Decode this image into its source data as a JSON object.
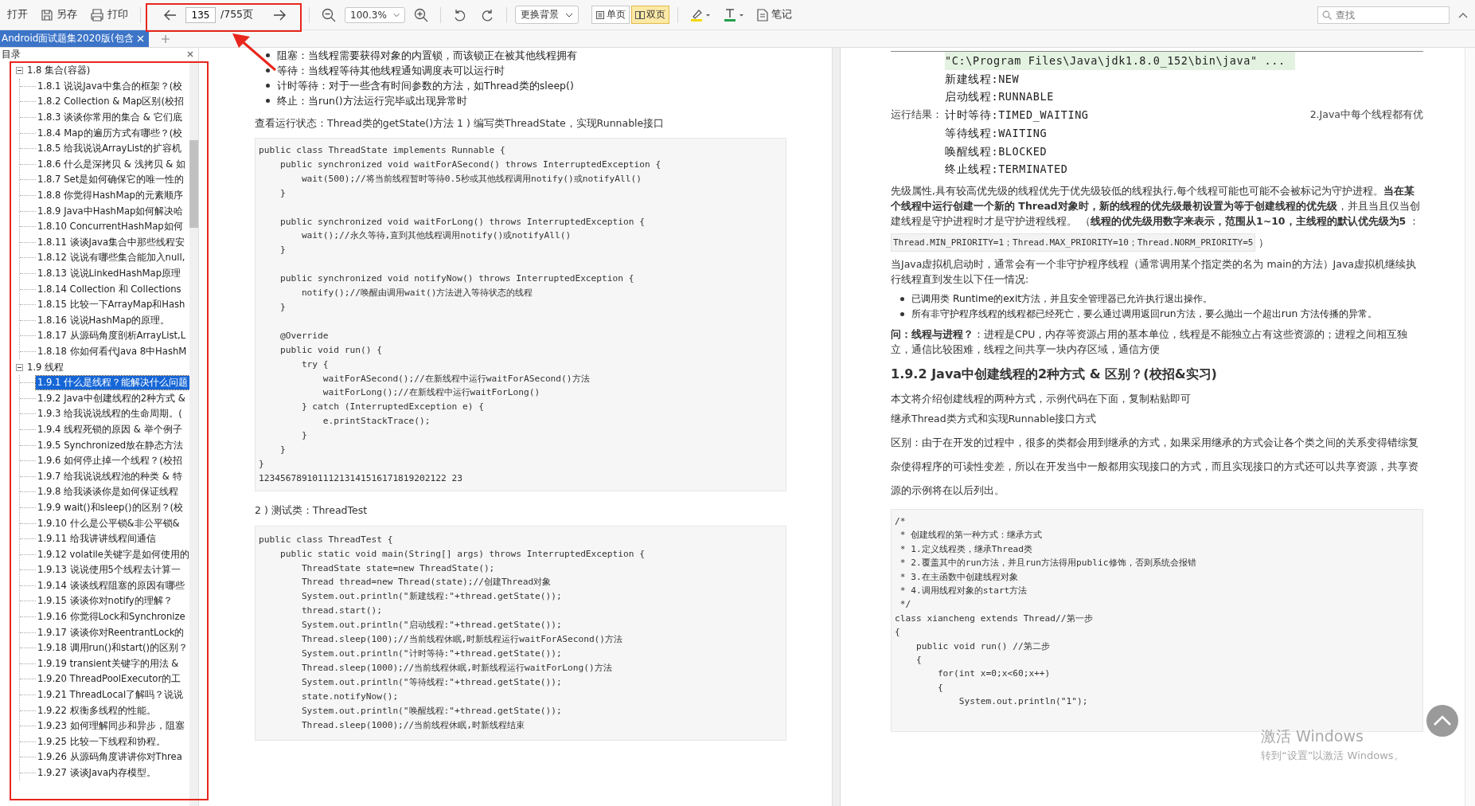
{
  "toolbar": {
    "open_button": {
      "label": "打开"
    },
    "save_button": {
      "label": "另存"
    },
    "print_button": {
      "label": "打印"
    },
    "page_nav": {
      "current": "135",
      "total": "/755页"
    },
    "zoom": {
      "value": "100.3%"
    },
    "background_select": {
      "label": "更换背景"
    },
    "view_modes": [
      {
        "label": "单页",
        "selected": false
      },
      {
        "label": "双页",
        "selected": true
      }
    ],
    "note_button": {
      "label": "笔记"
    },
    "search": {
      "placeholder": "查找"
    }
  },
  "tabs": [
    {
      "label": "Android面试题集2020版(包含",
      "selected": true
    }
  ],
  "sidebar": {
    "title": "目录",
    "items": [
      {
        "label": "1.8 集合(容器)",
        "expanded": true,
        "selected": false,
        "children": [
          {
            "label": "1.8.1 说说Java中集合的框架？(校",
            "selected": false
          },
          {
            "label": "1.8.2 Collection & Map区别(校招",
            "selected": false
          },
          {
            "label": "1.8.3 谈谈你常用的集合 & 它们底",
            "selected": false
          },
          {
            "label": "1.8.4 Map的遍历方式有哪些？(校",
            "selected": false
          },
          {
            "label": "1.8.5 给我说说ArrayList的扩容机",
            "selected": false
          },
          {
            "label": "1.8.6 什么是深拷贝 & 浅拷贝 & 如",
            "selected": false
          },
          {
            "label": "1.8.7 Set是如何确保它的唯一性的",
            "selected": false
          },
          {
            "label": "1.8.8 你觉得HashMap的元素顺序",
            "selected": false
          },
          {
            "label": "1.8.9 Java中HashMap如何解决哈",
            "selected": false
          },
          {
            "label": "1.8.10 ConcurrentHashMap如何",
            "selected": false
          },
          {
            "label": "1.8.11 谈谈Java集合中那些线程安",
            "selected": false
          },
          {
            "label": "1.8.12 说说有哪些集合能加入null,",
            "selected": false
          },
          {
            "label": "1.8.13 说说LinkedHashMap原理",
            "selected": false
          },
          {
            "label": "1.8.14 Collection 和 Collections",
            "selected": false
          },
          {
            "label": "1.8.15 比较一下ArrayMap和Hash",
            "selected": false
          },
          {
            "label": "1.8.16 说说HashMap的原理。",
            "selected": false
          },
          {
            "label": "1.8.17 从源码角度剖析ArrayList,L",
            "selected": false
          },
          {
            "label": "1.8.18 你如何看代Java 8中HashM",
            "selected": false
          }
        ]
      },
      {
        "label": "1.9 线程",
        "expanded": true,
        "selected": false,
        "children": [
          {
            "label": "1.9.1 什么是线程？能解决什么问题",
            "selected": true
          },
          {
            "label": "1.9.2 Java中创建线程的2种方式 &",
            "selected": false
          },
          {
            "label": "1.9.3 给我说说线程的生命周期。(",
            "selected": false
          },
          {
            "label": "1.9.4 线程死锁的原因 & 举个例子",
            "selected": false
          },
          {
            "label": "1.9.5 Synchronized放在静态方法",
            "selected": false
          },
          {
            "label": "1.9.6 如何停止掉一个线程？(校招",
            "selected": false
          },
          {
            "label": "1.9.7 给我说说线程池的种类 & 特",
            "selected": false
          },
          {
            "label": "1.9.8 给我谈谈你是如何保证线程",
            "selected": false
          },
          {
            "label": "1.9.9 wait()和sleep()的区别？(校",
            "selected": false
          },
          {
            "label": "1.9.10 什么是公平锁&非公平锁&",
            "selected": false
          },
          {
            "label": "1.9.11 给我讲讲线程间通信",
            "selected": false
          },
          {
            "label": "1.9.12 volatile关键字是如何使用的",
            "selected": false
          },
          {
            "label": "1.9.13 说说使用5个线程去计算一",
            "selected": false
          },
          {
            "label": "1.9.14 谈谈线程阻塞的原因有哪些",
            "selected": false
          },
          {
            "label": "1.9.15 谈谈你对notify的理解？",
            "selected": false
          },
          {
            "label": "1.9.16 你觉得Lock和Synchronize",
            "selected": false
          },
          {
            "label": "1.9.17 谈谈你对ReentrantLock的",
            "selected": false
          },
          {
            "label": "1.9.18 调用run()和start()的区别？",
            "selected": false
          },
          {
            "label": "1.9.19 transient关键字的用法 &",
            "selected": false
          },
          {
            "label": "1.9.20 ThreadPoolExecutor的工",
            "selected": false
          },
          {
            "label": "1.9.21 ThreadLocal了解吗？说说",
            "selected": false
          },
          {
            "label": "1.9.22 权衡多线程的性能。",
            "selected": false
          },
          {
            "label": "1.9.23 如何理解同步和异步，阻塞",
            "selected": false
          },
          {
            "label": "1.9.25 比较一下线程和协程。",
            "selected": false
          },
          {
            "label": "1.9.26 从源码角度讲讲你对Threa",
            "selected": false
          },
          {
            "label": "1.9.27 谈谈Java内存模型。",
            "selected": false
          }
        ]
      }
    ]
  },
  "left_page": {
    "bullets": [
      "阻塞：当线程需要获得对象的内置锁，而该锁正在被其他线程拥有",
      "等待：当线程等待其他线程通知调度表可以运行时",
      "计时等待：对于一些含有时间参数的方法，如Thread类的sleep()",
      "终止：当run()方法运行完毕或出现异常时"
    ],
    "paragraph": "查看运行状态：Thread类的getState()方法 1 ) 编写类ThreadState，实现Runnable接口",
    "code_1": "public class ThreadState implements Runnable {\n    public synchronized void waitForASecond() throws InterruptedException {\n        wait(500);//将当前线程暂时等待0.5秒或其他线程调用notify()或notifyAll()\n    }\n\n    public synchronized void waitForLong() throws InterruptedException {\n        wait();//永久等待,直到其他线程调用notify()或notifyAll()\n    }\n\n    public synchronized void notifyNow() throws InterruptedException {\n        notify();//唤醒由调用wait()方法进入等待状态的线程\n    }\n\n    @Override\n    public void run() {\n        try {\n            waitForASecond();//在新线程中运行waitForASecond()方法\n            waitForLong();//在新线程中运行waitForLong()\n        } catch (InterruptedException e) {\n            e.printStackTrace();\n        }\n    }\n}\n12345678910111213141516171819202122 23",
    "caption": "2 ) 测试类：ThreadTest",
    "code_2": "public class ThreadTest {\n    public static void main(String[] args) throws InterruptedException {\n        ThreadState state=new ThreadState();\n        Thread thread=new Thread(state);//创建Thread对象\n        System.out.println(\"新建线程:\"+thread.getState());\n        thread.start();\n        System.out.println(\"启动线程:\"+thread.getState());\n        Thread.sleep(100);//当前线程休眠,时新线程运行waitForASecond()方法\n        System.out.println(\"计时等待:\"+thread.getState());\n        Thread.sleep(1000);//当前线程休眠,时新线程运行waitForLong()方法\n        System.out.println(\"等待线程:\"+thread.getState());\n        state.notifyNow();\n        System.out.println(\"唤醒线程:\"+thread.getState());\n        Thread.sleep(1000);//当前线程休眠,时新线程结束"
  },
  "right_page": {
    "result_label": "运行结果：",
    "console_lines": [
      "\"C:\\Program Files\\Java\\jdk1.8.0_152\\bin\\java\" ...",
      "新建线程:NEW",
      "启动线程:RUNNABLE",
      "计时等待:TIMED_WAITING",
      "等待线程:WAITING",
      "唤醒线程:BLOCKED",
      "终止线程:TERMINATED"
    ],
    "side_note": "2.Java中每个线程都有优",
    "paragraph_1": "先级属性,具有较高优先级的线程优先于优先级较低的线程执行,每个线程可能也可能不会被标记为守护进程。**当在某个线程中运行创建一个新的 Thread对象时，新的线程的优先级最初设置为等于创建线程的优先级**，并且当且仅当创建线程是守护进程时才是守护进程线程。 （**线程的优先级用数字来表示，范围从1~10，主线程的默认优先级为5** ：",
    "inline_code": "Thread.MIN_PRIORITY=1；Thread.MAX_PRIORITY=10；Thread.NORM_PRIORITY=5",
    "inline_code_after": "）",
    "paragraph_2": "当Java虚拟机启动时，通常会有一个非守护程序线程（通常调用某个指定类的名为 main的方法）Java虚拟机继续执行线程直到发生以下任一情况:",
    "bullets": [
      "已调用类 Runtime的exit方法，并且安全管理器已允许执行退出操作。",
      "所有非守护程序线程的线程都已经死亡，要么通过调用返回run方法，要么抛出一个超出run 方法传播的异常。"
    ],
    "qa": "**问：线程与进程？**：进程是CPU，内存等资源占用的基本单位，线程是不能独立占有这些资源的；进程之间相互独立，通信比较困难，线程之间共享一块内存区域，通信方便",
    "heading": "1.9.2 Java中创建线程的2种方式 & 区别？(校招&实习)",
    "paragraph_3": "本文将介绍创建线程的两种方式，示例代码在下面，复制粘贴即可",
    "paragraph_4": "继承Thread类方式和实现Runnable接口方式",
    "paragraph_5": "区别：由于在开发的过程中，很多的类都会用到继承的方式，如果采用继承的方式会让各个类之间的关系变得错综复杂使得程序的可读性变差，所以在开发当中一般都用实现接口的方式，而且实现接口的方式还可以共享资源，共享资源的示例将在以后列出。",
    "code_3": "/*\n * 创建线程的第一种方式：继承方式\n * 1.定义线程类，继承Thread类\n * 2.覆盖其中的run方法，并且run方法得用public修饰，否则系统会报错\n * 3.在主函数中创建线程对象\n * 4.调用线程对象的start方法\n */\nclass xiancheng extends Thread//第一步\n{\n    public void run() //第二步\n    {\n        for(int x=0;x<60;x++)\n        {\n            System.out.println(\"1\");"
  },
  "os_notice": {
    "title": "激活 Windows",
    "subtitle": "转到“设置”以激活 Windows。"
  }
}
